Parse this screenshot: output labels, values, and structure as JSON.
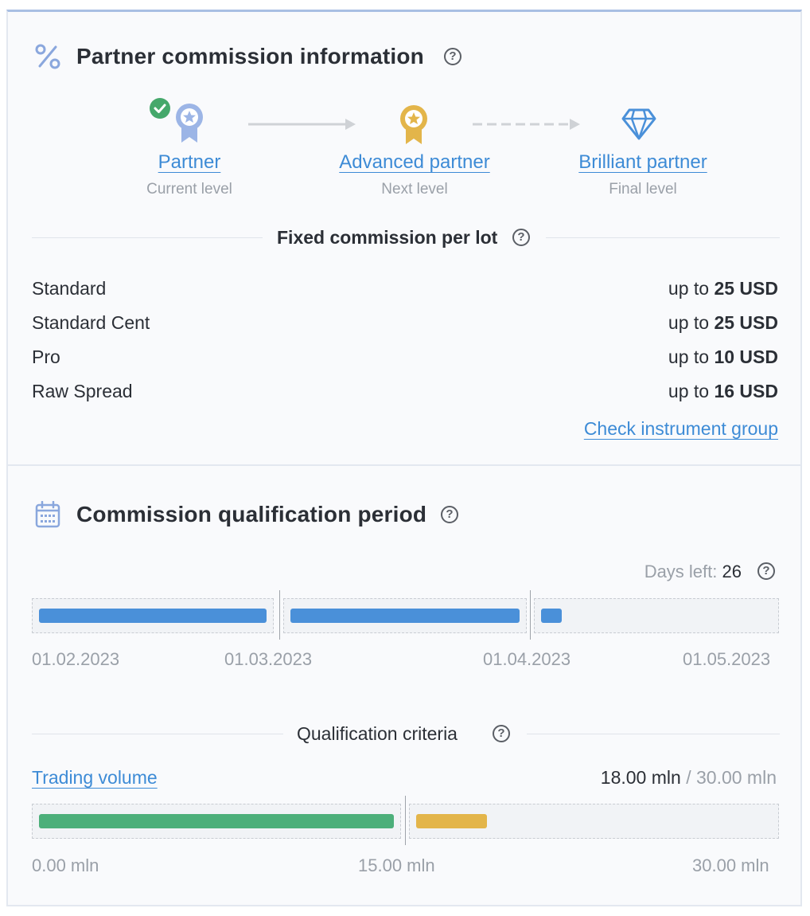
{
  "commission": {
    "title": "Partner commission information",
    "levels": [
      {
        "name": "Partner",
        "status": "Current level",
        "icon": "medal-blue-icon"
      },
      {
        "name": "Advanced partner",
        "status": "Next level",
        "icon": "medal-gold-icon"
      },
      {
        "name": "Brilliant partner",
        "status": "Final level",
        "icon": "diamond-icon"
      }
    ],
    "fixed_title": "Fixed commission per lot",
    "rows": [
      {
        "label": "Standard",
        "prefix": "up to",
        "value": "25 USD"
      },
      {
        "label": "Standard Cent",
        "prefix": "up to",
        "value": "25 USD"
      },
      {
        "label": "Pro",
        "prefix": "up to",
        "value": "10 USD"
      },
      {
        "label": "Raw Spread",
        "prefix": "up to",
        "value": "16 USD"
      }
    ],
    "check_link": "Check instrument group"
  },
  "qualification": {
    "title": "Commission qualification period",
    "days_left_label": "Days left:",
    "days_left_value": "26",
    "period_progress": [
      1.0,
      1.0,
      0.09
    ],
    "dates": [
      "01.02.2023",
      "01.03.2023",
      "01.04.2023",
      "01.05.2023"
    ],
    "criteria_title": "Qualification criteria",
    "volume_label": "Trading volume",
    "volume_current": "18.00 mln",
    "volume_sep": "/",
    "volume_target": "30.00 mln",
    "volume_fill": [
      1.0,
      0.2
    ],
    "volume_ticks": [
      "0.00 mln",
      "15.00 mln",
      "30.00 mln"
    ]
  },
  "colors": {
    "accent_blue": "#4a90d9",
    "link_blue": "#3d8bd6",
    "green": "#4caf7a",
    "gold": "#e3b54a"
  }
}
